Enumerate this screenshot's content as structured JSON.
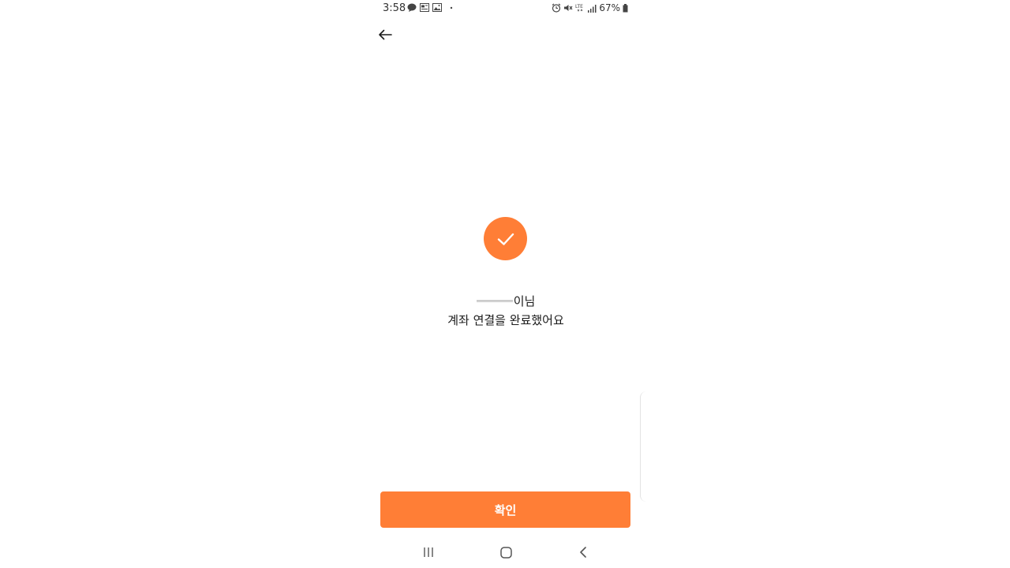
{
  "status_bar": {
    "time": "3:58",
    "battery": "67%",
    "network": "LTE",
    "left_icons": [
      "chat-bubble-icon",
      "news-icon",
      "image-icon",
      "dot-icon"
    ],
    "right_icons": [
      "alarm-icon",
      "mute-icon",
      "lte-icon",
      "signal-icon",
      "battery-icon"
    ]
  },
  "header": {
    "back_icon": "arrow-left-icon"
  },
  "success": {
    "icon": "check-icon",
    "name_suffix": "이님",
    "message": "계좌 연결을 완료했어요"
  },
  "confirm_button": {
    "label": "확인"
  },
  "nav_bar": {
    "items": [
      "recent-apps-icon",
      "home-icon",
      "back-icon"
    ]
  },
  "colors": {
    "accent": "#ff7e36",
    "text": "#1a1a1a",
    "background": "#ffffff"
  }
}
